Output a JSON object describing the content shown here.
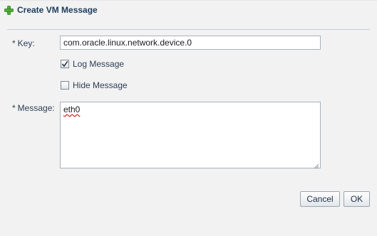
{
  "dialog": {
    "title": "Create VM Message",
    "icon": "plus-icon"
  },
  "form": {
    "key_required": "*",
    "key_label": "Key:",
    "key_value": "com.oracle.linux.network.device.0",
    "log_message_label": "Log Message",
    "log_message_checked": true,
    "hide_message_label": "Hide Message",
    "hide_message_checked": false,
    "message_required": "*",
    "message_label": "Message:",
    "message_value": "eth0"
  },
  "buttons": {
    "cancel_label": "Cancel",
    "ok_label": "OK"
  },
  "colors": {
    "accent_plus": "#3a9a2a",
    "title_text": "#1d3b5c",
    "spellcheck": "#d02020"
  }
}
